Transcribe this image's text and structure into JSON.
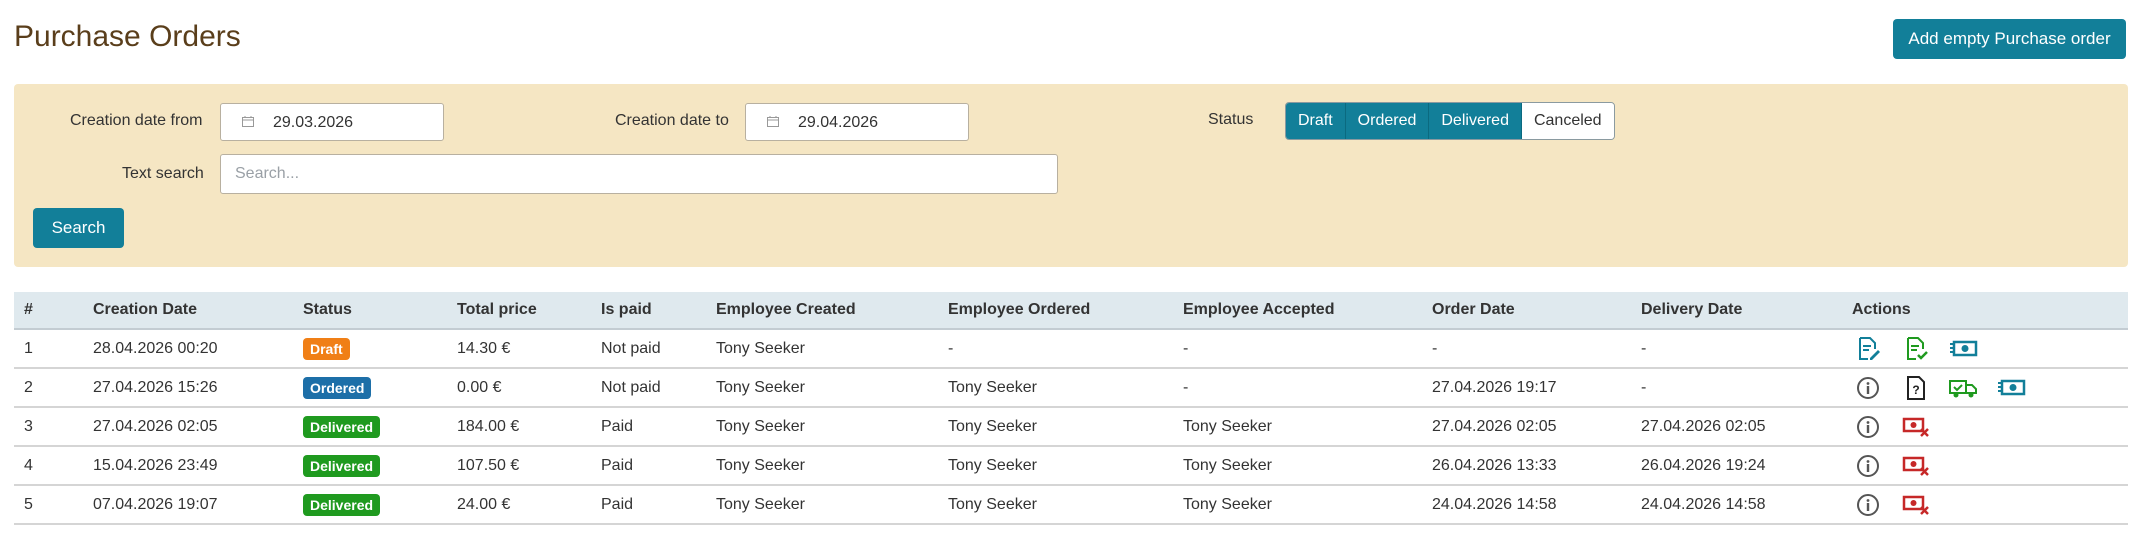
{
  "header": {
    "title": "Purchase Orders",
    "add_button_label": "Add empty Purchase order"
  },
  "filters": {
    "date_from_label": "Creation date from",
    "date_from_value": "29.03.2026",
    "date_to_label": "Creation date to",
    "date_to_value": "29.04.2026",
    "status_label": "Status",
    "status_options": [
      {
        "label": "Draft",
        "selected": true
      },
      {
        "label": "Ordered",
        "selected": true
      },
      {
        "label": "Delivered",
        "selected": true
      },
      {
        "label": "Canceled",
        "selected": false
      }
    ],
    "text_search_label": "Text search",
    "text_search_placeholder": "Search...",
    "text_search_value": "",
    "search_button_label": "Search"
  },
  "table": {
    "columns": [
      "#",
      "Creation Date",
      "Status",
      "Total price",
      "Is paid",
      "Employee Created",
      "Employee Ordered",
      "Employee Accepted",
      "Order Date",
      "Delivery Date",
      "Actions"
    ],
    "rows": [
      {
        "num": "1",
        "created": "28.04.2026 00:20",
        "status": "Draft",
        "price": "14.30 €",
        "paid": "Not paid",
        "emp_created": "Tony Seeker",
        "emp_ordered": "-",
        "emp_accepted": "-",
        "order_date": "-",
        "delivery_date": "-",
        "actions": [
          "edit-document-icon",
          "approve-document-icon",
          "payment-icon"
        ]
      },
      {
        "num": "2",
        "created": "27.04.2026 15:26",
        "status": "Ordered",
        "price": "0.00 €",
        "paid": "Not paid",
        "emp_created": "Tony Seeker",
        "emp_ordered": "Tony Seeker",
        "emp_accepted": "-",
        "order_date": "27.04.2026 19:17",
        "delivery_date": "-",
        "actions": [
          "info-icon",
          "unknown-document-icon",
          "delivery-truck-icon",
          "payment-icon"
        ]
      },
      {
        "num": "3",
        "created": "27.04.2026 02:05",
        "status": "Delivered",
        "price": "184.00 €",
        "paid": "Paid",
        "emp_created": "Tony Seeker",
        "emp_ordered": "Tony Seeker",
        "emp_accepted": "Tony Seeker",
        "order_date": "27.04.2026 02:05",
        "delivery_date": "27.04.2026 02:05",
        "actions": [
          "info-icon",
          "cancel-payment-icon"
        ]
      },
      {
        "num": "4",
        "created": "15.04.2026 23:49",
        "status": "Delivered",
        "price": "107.50 €",
        "paid": "Paid",
        "emp_created": "Tony Seeker",
        "emp_ordered": "Tony Seeker",
        "emp_accepted": "Tony Seeker",
        "order_date": "26.04.2026 13:33",
        "delivery_date": "26.04.2026 19:24",
        "actions": [
          "info-icon",
          "cancel-payment-icon"
        ]
      },
      {
        "num": "5",
        "created": "07.04.2026 19:07",
        "status": "Delivered",
        "price": "24.00 €",
        "paid": "Paid",
        "emp_created": "Tony Seeker",
        "emp_ordered": "Tony Seeker",
        "emp_accepted": "Tony Seeker",
        "order_date": "24.04.2026 14:58",
        "delivery_date": "24.04.2026 14:58",
        "actions": [
          "info-icon",
          "cancel-payment-icon"
        ]
      }
    ]
  },
  "colors": {
    "accent": "#127f99",
    "filter_bg": "#f5e6c3",
    "title": "#5a3e1b",
    "draft": "#f07f16",
    "ordered": "#1d6fa8",
    "delivered": "#1f9a1f",
    "not_paid": "#b01818",
    "paid": "#1f8a1f"
  }
}
